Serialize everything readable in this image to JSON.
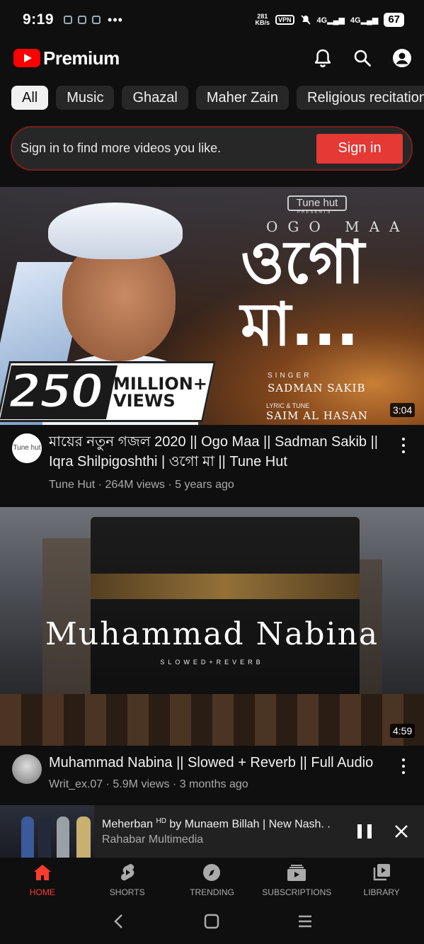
{
  "status_bar": {
    "time": "9:19",
    "dots": "•••",
    "speed_top": "281",
    "speed_bottom": "KB/s",
    "vpn": "VPN",
    "signal1": "4G",
    "signal2": "4G",
    "battery": "67"
  },
  "header": {
    "logo_text": "Premium",
    "brand_color": "#ff0000"
  },
  "chips": [
    "All",
    "Music",
    "Ghazal",
    "Maher Zain",
    "Religious recitation"
  ],
  "signin": {
    "prompt": "Sign in to find more videos you like.",
    "button": "Sign in",
    "button_color": "#e53935"
  },
  "videos": [
    {
      "thumbnail": {
        "brand": "Tune hut",
        "presents": "PRESENTS",
        "title_en": "OGO MAA",
        "title_bn": "ওগো মা...",
        "views_number": "250",
        "views_text_1": "MILLION+",
        "views_text_2": "VIEWS",
        "singer_label": "SINGER",
        "singer_name": "SADMAN SAKIB",
        "lyric_label": "LYRIC & TUNE",
        "lyric_name": "SAIM AL HASAN"
      },
      "duration": "3:04",
      "avatar_text": "Tune hut",
      "title": "মায়ের নতুন গজল 2020 || Ogo Maa || Sadman Sakib || Iqra Shilpigoshthi | ওগো মা || Tune Hut",
      "channel": "Tune Hut",
      "views": "264M views",
      "age": "5 years ago"
    },
    {
      "thumbnail": {
        "title": "Muhammad Nabina",
        "subtitle": "SLOWED+REVERB"
      },
      "duration": "4:59",
      "title": "Muhammad Nabina || Slowed + Reverb || Full Audio",
      "channel": "Writ_ex.07",
      "views": "5.9M views",
      "age": "3 months ago"
    }
  ],
  "separator": "·",
  "mini_player": {
    "title_pre": "Meherban ",
    "title_sup": "HD",
    "title_post": " by Munaem Billah | New Nash. .",
    "channel": "Rahabar Multimedia"
  },
  "bottom_nav": [
    {
      "label": "HOME",
      "icon": "home-icon"
    },
    {
      "label": "SHORTS",
      "icon": "shorts-icon"
    },
    {
      "label": "TRENDING",
      "icon": "trending-icon"
    },
    {
      "label": "SUBSCRIPTIONS",
      "icon": "subscriptions-icon"
    },
    {
      "label": "LIBRARY",
      "icon": "library-icon"
    }
  ],
  "active_nav_color": "#ff3b30"
}
